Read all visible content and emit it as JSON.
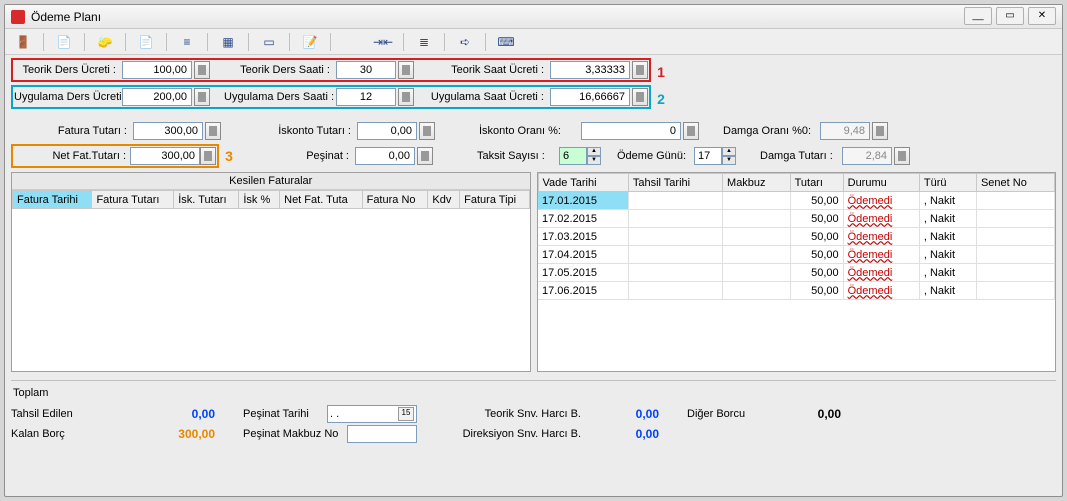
{
  "window": {
    "title": "Ödeme Planı"
  },
  "titlectrls": {
    "min": "__",
    "max": "▭",
    "close": "✕"
  },
  "annotations": {
    "r1": "1",
    "r2": "2",
    "r3": "3"
  },
  "row1": {
    "f1_label": "Teorik Ders Ücreti :",
    "f1_value": "100,00",
    "f2_label": "Teorik Ders Saati :",
    "f2_value": "30",
    "f3_label": "Teorik Saat Ücreti :",
    "f3_value": "3,33333"
  },
  "row2": {
    "f1_label": "Uygulama Ders Ücreti :",
    "f1_value": "200,00",
    "f2_label": "Uygulama Ders Saati :",
    "f2_value": "12",
    "f3_label": "Uygulama Saat Ücreti :",
    "f3_value": "16,66667"
  },
  "row3": {
    "fat_label": "Fatura Tutarı :",
    "fat_value": "300,00",
    "isk_label": "İskonto Tutarı :",
    "isk_value": "0,00",
    "oran_label": "İskonto Oranı %:",
    "oran_value": "0",
    "damga_oran_label": "Damga Oranı %0:",
    "damga_oran_value": "9,48"
  },
  "row4": {
    "net_label": "Net  Fat.Tutarı :",
    "net_value": "300,00",
    "pesinat_label": "Peşinat :",
    "pesinat_value": "0,00",
    "taksit_label": "Taksit Sayısı :",
    "taksit_value": "6",
    "odeme_gunu_label": "Ödeme Günü:",
    "odeme_gunu_value": "17",
    "damga_tutar_label": "Damga Tutarı :",
    "damga_tutar_value": "2,84"
  },
  "left_table": {
    "title": "Kesilen Faturalar",
    "headers": [
      "Fatura Tarihi",
      "Fatura Tutarı",
      "İsk. Tutarı",
      "İsk %",
      "Net Fat. Tuta",
      "Fatura No",
      "Kdv",
      "Fatura Tipi"
    ]
  },
  "right_table": {
    "headers": [
      "Vade Tarihi",
      "Tahsil Tarihi",
      "Makbuz",
      "Tutarı",
      "Durumu",
      "Türü",
      "Senet No"
    ],
    "rows": [
      {
        "vade": "17.01.2015",
        "tahsil": "",
        "makbuz": "",
        "tutar": "50,00",
        "durum": "Ödemedi",
        "tur": "Nakit",
        "senet": ""
      },
      {
        "vade": "17.02.2015",
        "tahsil": "",
        "makbuz": "",
        "tutar": "50,00",
        "durum": "Ödemedi",
        "tur": "Nakit",
        "senet": ""
      },
      {
        "vade": "17.03.2015",
        "tahsil": "",
        "makbuz": "",
        "tutar": "50,00",
        "durum": "Ödemedi",
        "tur": "Nakit",
        "senet": ""
      },
      {
        "vade": "17.04.2015",
        "tahsil": "",
        "makbuz": "",
        "tutar": "50,00",
        "durum": "Ödemedi",
        "tur": "Nakit",
        "senet": ""
      },
      {
        "vade": "17.05.2015",
        "tahsil": "",
        "makbuz": "",
        "tutar": "50,00",
        "durum": "Ödemedi",
        "tur": "Nakit",
        "senet": ""
      },
      {
        "vade": "17.06.2015",
        "tahsil": "",
        "makbuz": "",
        "tutar": "50,00",
        "durum": "Ödemedi",
        "tur": "Nakit",
        "senet": ""
      }
    ]
  },
  "footer": {
    "toplam": "Toplam",
    "tahsil_label": "Tahsil Edilen",
    "tahsil_value": "0,00",
    "kalan_label": "Kalan Borç",
    "kalan_value": "300,00",
    "pesinat_tarihi_label": "Peşinat Tarihi",
    "pesinat_tarihi_value": ".  .",
    "makbuz_label": "Peşinat Makbuz No",
    "teorik_harc_label": "Teorik Snv. Harcı B.",
    "teorik_harc_value": "0,00",
    "direksiyon_harc_label": "Direksiyon Snv. Harcı B.",
    "direksiyon_harc_value": "0,00",
    "diger_label": "Diğer Borcu",
    "diger_value": "0,00"
  }
}
